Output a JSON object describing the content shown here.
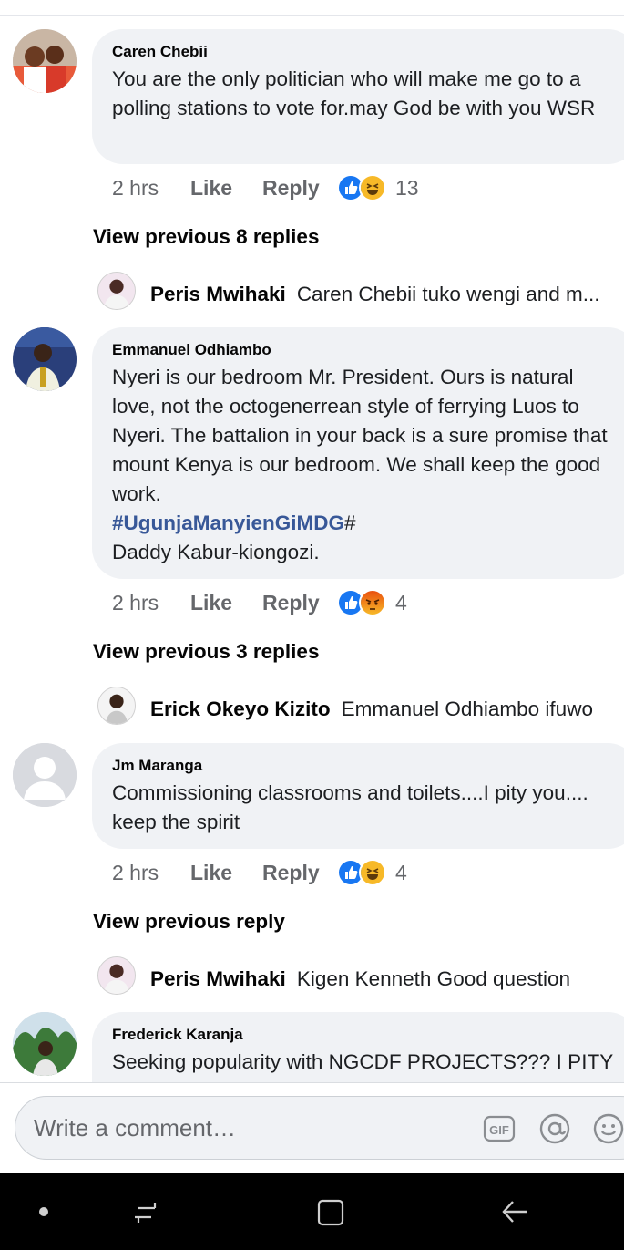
{
  "comments": [
    {
      "author": "Caren Chebii",
      "text": "You are the only politician who will make me go to a polling stations to vote for.may  God be with you WSR",
      "time": "2 hrs",
      "like_label": "Like",
      "reply_label": "Reply",
      "reaction_count": "13",
      "reactions": [
        "like-icon",
        "haha-icon"
      ],
      "view_previous": "View previous 8 replies",
      "latest_reply": {
        "author": "Peris Mwihaki",
        "text": "Caren Chebii tuko wengi and m..."
      }
    },
    {
      "author": "Emmanuel Odhiambo",
      "text_lines": [
        "Nyeri is our bedroom Mr. President. Ours is natural love, not the octogenerrean style of ferrying Luos to Nyeri. The battalion in your back is a sure promise that mount Kenya is our bedroom. We shall keep the good work."
      ],
      "hashtag": "#UgunjaManyienGiMDG",
      "hashtag_suffix": "#",
      "signoff": "Daddy Kabur-kiongozi.",
      "time": "2 hrs",
      "like_label": "Like",
      "reply_label": "Reply",
      "reaction_count": "4",
      "reactions": [
        "like-icon",
        "angry-icon"
      ],
      "view_previous": "View previous 3 replies",
      "latest_reply": {
        "author": "Erick Okeyo Kizito",
        "text": "Emmanuel Odhiambo ifuwo"
      }
    },
    {
      "author": "Jm Maranga",
      "text": "Commissioning classrooms and toilets....I pity you.... keep the spirit",
      "time": "2 hrs",
      "like_label": "Like",
      "reply_label": "Reply",
      "reaction_count": "4",
      "reactions": [
        "like-icon",
        "haha-icon"
      ],
      "view_previous": "View previous reply",
      "latest_reply": {
        "author": "Peris Mwihaki",
        "text": "Kigen Kenneth Good question"
      }
    },
    {
      "author": "Frederick Karanja",
      "text": "Seeking popularity with NGCDF PROJECTS??? I PITY"
    }
  ],
  "composer": {
    "placeholder": "Write a comment…",
    "icons": [
      "gif-icon",
      "mention-icon",
      "emoji-icon"
    ]
  },
  "navbar": {
    "buttons": [
      "dot-icon",
      "recent-apps-icon",
      "home-icon",
      "back-icon"
    ]
  },
  "colors": {
    "bubble": "#f0f2f5",
    "secondary_text": "#65676b",
    "hashtag": "#385898",
    "like_blue": "#1877f2",
    "haha_yellow": "#f7b928",
    "angry_orange": "#e9710f"
  }
}
